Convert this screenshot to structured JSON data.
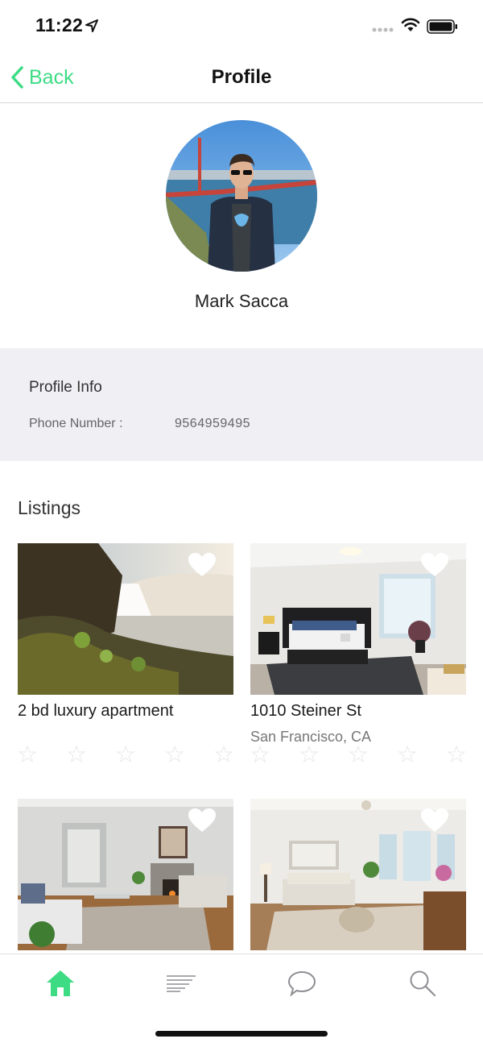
{
  "status_bar": {
    "time": "11:22"
  },
  "nav": {
    "back_label": "Back",
    "title": "Profile"
  },
  "profile": {
    "name": "Mark Sacca"
  },
  "profile_info": {
    "title": "Profile Info",
    "phone_label": "Phone Number :",
    "phone_value": "9564959495"
  },
  "listings": {
    "title": "Listings",
    "items": [
      {
        "title": "2 bd luxury apartment",
        "subtitle": "",
        "image": "waterfall-photo"
      },
      {
        "title": "1010 Steiner St",
        "subtitle": "San Francisco, CA",
        "image": "bedroom-photo"
      },
      {
        "title": "",
        "subtitle": "",
        "image": "living-room-photo"
      },
      {
        "title": "",
        "subtitle": "",
        "image": "dining-living-room-photo"
      }
    ]
  },
  "tab_bar": {
    "tabs": [
      {
        "icon": "home-icon",
        "active": true
      },
      {
        "icon": "list-icon",
        "active": false
      },
      {
        "icon": "chat-bubble-icon",
        "active": false
      },
      {
        "icon": "search-icon",
        "active": false
      }
    ]
  },
  "colors": {
    "accent": "#3ddc84",
    "info_background": "#efeff4",
    "inactive_icon": "#8e8e93"
  }
}
